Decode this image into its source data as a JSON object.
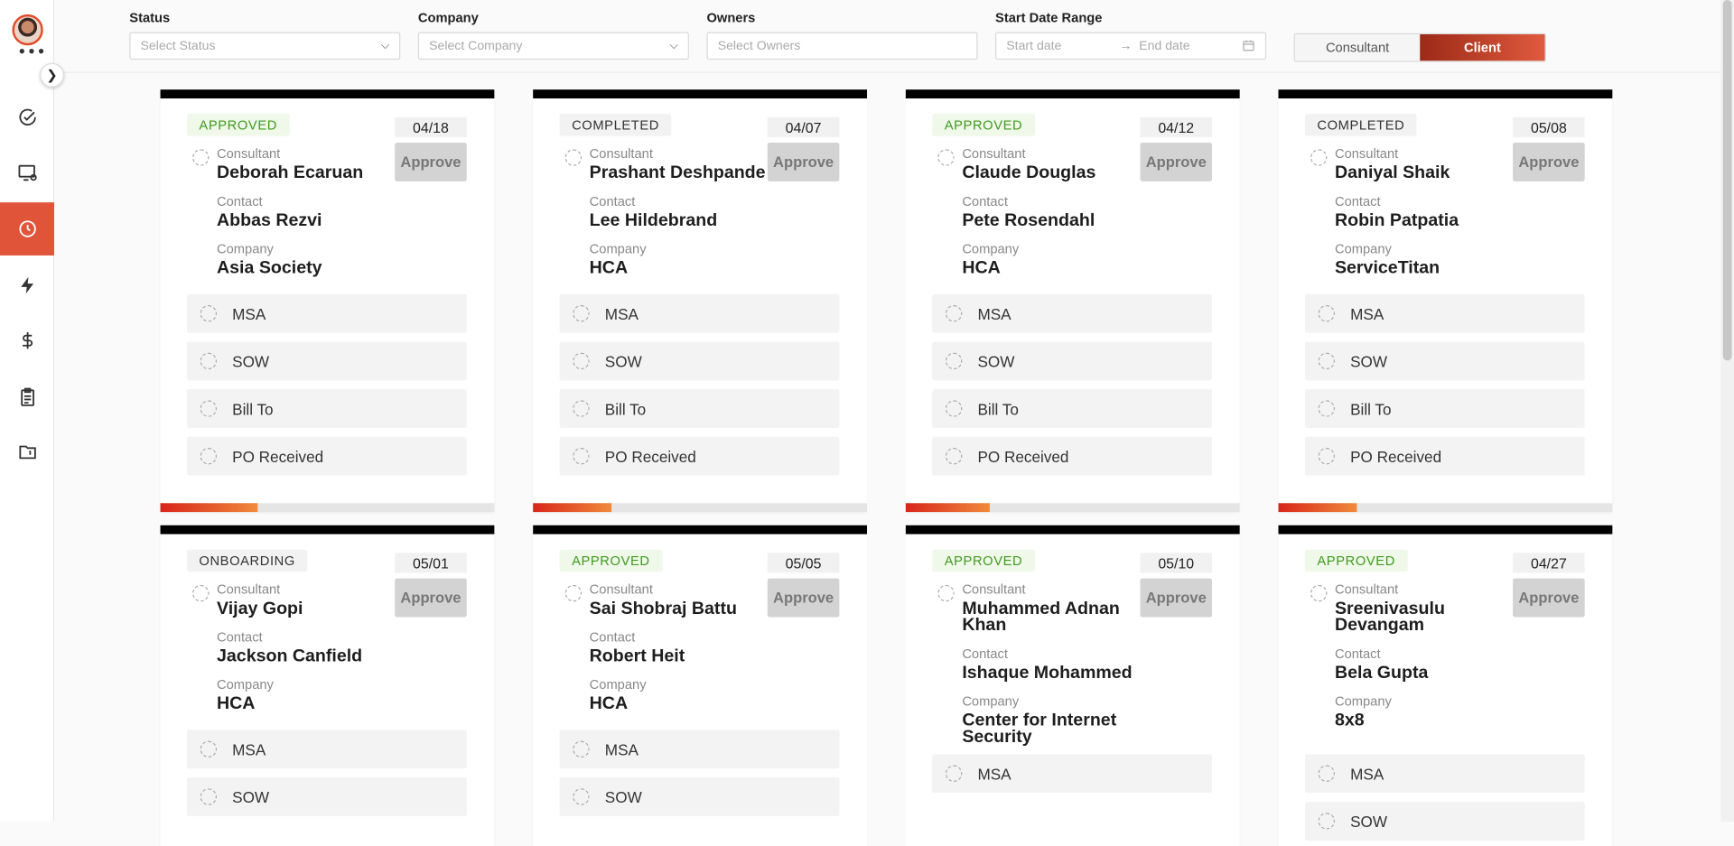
{
  "filters": {
    "status": {
      "label": "Status",
      "placeholder": "Select Status"
    },
    "company": {
      "label": "Company",
      "placeholder": "Select Company"
    },
    "owners": {
      "label": "Owners",
      "placeholder": "Select Owners"
    },
    "date_range": {
      "label": "Start Date Range",
      "start_placeholder": "Start date",
      "end_placeholder": "End date",
      "arrow": "→"
    }
  },
  "toggle": {
    "consultant": "Consultant",
    "client": "Client",
    "selected": "Client"
  },
  "sidebar": {
    "avatar_dots": "•••",
    "items": [
      {
        "icon": "check-circle-icon"
      },
      {
        "icon": "screen-settings-icon"
      },
      {
        "icon": "clock-icon",
        "active": true
      },
      {
        "icon": "lightning-icon"
      },
      {
        "icon": "dollar-icon"
      },
      {
        "icon": "clipboard-icon"
      },
      {
        "icon": "book-icon"
      }
    ]
  },
  "labels": {
    "consultant": "Consultant",
    "contact": "Contact",
    "company": "Company",
    "approve": "Approve"
  },
  "cards": [
    {
      "status": "APPROVED",
      "date": "04/18",
      "consultant": "Deborah Ecaruan",
      "contact": "Abbas Rezvi",
      "company": "Asia Society",
      "docs": [
        "MSA",
        "SOW",
        "Bill To",
        "PO Received"
      ],
      "progress": 0.29
    },
    {
      "status": "COMPLETED",
      "date": "04/07",
      "consultant": "Prashant Deshpande",
      "contact": "Lee Hildebrand",
      "company": "HCA",
      "docs": [
        "MSA",
        "SOW",
        "Bill To",
        "PO Received"
      ],
      "progress": 0.235
    },
    {
      "status": "APPROVED",
      "date": "04/12",
      "consultant": "Claude Douglas",
      "contact": "Pete Rosendahl",
      "company": "HCA",
      "docs": [
        "MSA",
        "SOW",
        "Bill To",
        "PO Received"
      ],
      "progress": 0.25
    },
    {
      "status": "COMPLETED",
      "date": "05/08",
      "consultant": "Daniyal Shaik",
      "contact": "Robin Patpatia",
      "company": "ServiceTitan",
      "docs": [
        "MSA",
        "SOW",
        "Bill To",
        "PO Received"
      ],
      "progress": 0.235
    },
    {
      "status": "ONBOARDING",
      "date": "05/01",
      "consultant": "Vijay Gopi",
      "contact": "Jackson Canfield",
      "company": "HCA",
      "docs": [
        "MSA",
        "SOW"
      ]
    },
    {
      "status": "APPROVED",
      "date": "05/05",
      "consultant": "Sai Shobraj Battu",
      "contact": "Robert Heit",
      "company": "HCA",
      "docs": [
        "MSA",
        "SOW"
      ]
    },
    {
      "status": "APPROVED",
      "date": "05/10",
      "consultant": "Muhammed Adnan Khan",
      "contact": "Ishaque Mohammed",
      "company": "Center for Internet Security",
      "docs": [
        "MSA"
      ]
    },
    {
      "status": "APPROVED",
      "date": "04/27",
      "consultant": "Sreenivasulu Devangam",
      "contact": "Bela Gupta",
      "company": "8x8",
      "docs": [
        "MSA",
        "SOW"
      ]
    }
  ]
}
